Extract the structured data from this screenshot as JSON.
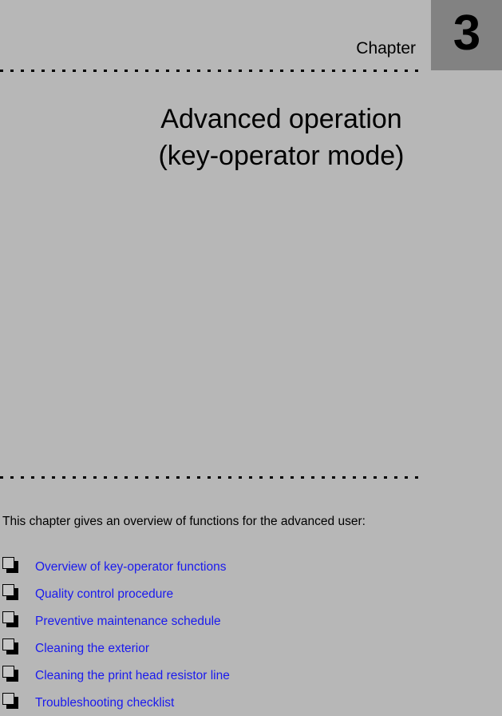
{
  "header": {
    "chapter_label": "Chapter",
    "chapter_number": "3",
    "number_box_color": "#828282",
    "page_background_color": "#b7b7b7"
  },
  "title": {
    "line1": "Advanced operation",
    "line2": "(key-operator mode)"
  },
  "intro": {
    "text": "This chapter gives an overview of functions for the advanced user:"
  },
  "topics": {
    "link_color": "#1a1aee",
    "bullet_icon": "box-bullet-icon",
    "items": [
      {
        "label": "Overview of key-operator functions"
      },
      {
        "label": "Quality control procedure"
      },
      {
        "label": "Preventive maintenance schedule"
      },
      {
        "label": "Cleaning the exterior"
      },
      {
        "label": "Cleaning the print head resistor line"
      },
      {
        "label": "Troubleshooting checklist"
      }
    ]
  }
}
